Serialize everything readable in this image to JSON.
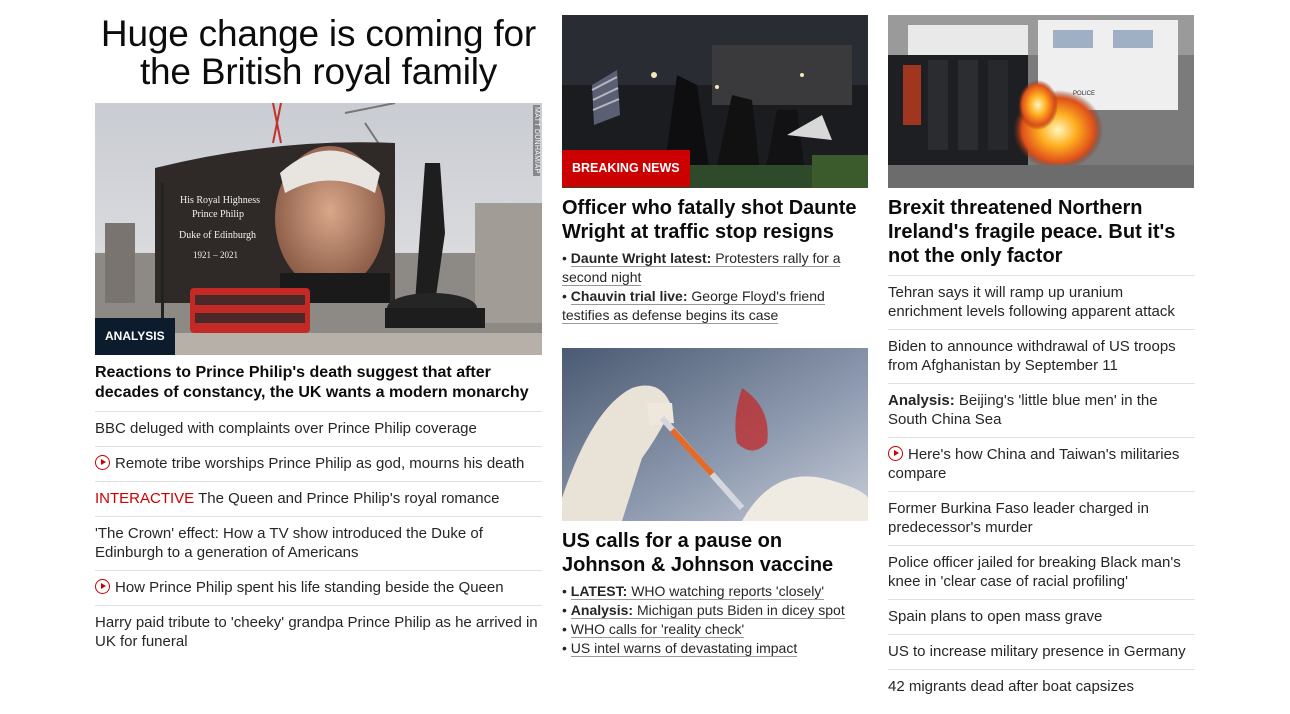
{
  "col1": {
    "title": "Huge change is coming for the British royal family",
    "image": {
      "badge": "ANALYSIS",
      "credit": "MATT DUNHAM/AP",
      "screen_lines": [
        "His Royal Highness",
        "Prince Philip",
        "Duke of Edinburgh",
        "1921 – 2021"
      ]
    },
    "caption": "Reactions to Prince Philip's death suggest that after decades of constancy, the UK wants a modern monarchy",
    "items": [
      {
        "text": "BBC deluged with complaints over Prince Philip coverage"
      },
      {
        "icon": "play-icon",
        "text": "Remote tribe worships Prince Philip as god, mourns his death"
      },
      {
        "prefix": "INTERACTIVE",
        "text": "The Queen and Prince Philip's royal romance"
      },
      {
        "text": "'The Crown' effect: How a TV show introduced the Duke of Edinburgh to a generation of Americans"
      },
      {
        "icon": "play-icon",
        "text": "How Prince Philip spent his life standing beside the Queen"
      },
      {
        "text": "Harry paid tribute to 'cheeky' grandpa Prince Philip as he arrived in UK for funeral"
      }
    ]
  },
  "col2": {
    "story1": {
      "badge": "BREAKING NEWS",
      "headline": "Officer who fatally shot Daunte Wright at traffic stop resigns",
      "bullets": [
        {
          "kicker": "Daunte Wright latest:",
          "text": "Protesters rally for a second night"
        },
        {
          "kicker": "Chauvin trial live:",
          "text": "George Floyd's friend testifies as defense begins its case"
        }
      ]
    },
    "story2": {
      "headline": "US calls for a pause on Johnson & Johnson vaccine",
      "bullets": [
        {
          "kicker": "LATEST:",
          "text": "WHO watching reports 'closely'"
        },
        {
          "kicker": "Analysis:",
          "text": "Michigan puts Biden in dicey spot"
        },
        {
          "kicker": "",
          "text": "WHO calls for 'reality check'"
        },
        {
          "kicker": "",
          "text": "US intel warns of devastating impact"
        }
      ]
    }
  },
  "col3": {
    "headline": "Brexit threatened Northern Ireland's fragile peace. But it's not the only factor",
    "image": {
      "vehicle_text": "POLICE"
    },
    "items": [
      {
        "text": "Tehran says it will ramp up uranium enrichment levels following apparent attack"
      },
      {
        "text": "Biden to announce withdrawal of US troops from Afghanistan by September 11"
      },
      {
        "prefix": "Analysis:",
        "text": "Beijing's 'little blue men' in the South China Sea"
      },
      {
        "icon": "play-icon",
        "text": "Here's how China and Taiwan's militaries compare"
      },
      {
        "text": "Former Burkina Faso leader charged in predecessor's murder"
      },
      {
        "text": "Police officer jailed for breaking Black man's knee in 'clear case of racial profiling'"
      },
      {
        "text": "Spain plans to open mass grave"
      },
      {
        "text": "US to increase military presence in Germany"
      },
      {
        "text": "42 migrants dead after boat capsizes"
      }
    ]
  },
  "colors": {
    "accent_red": "#cc0000",
    "analysis_badge": "#0c1c2c",
    "text": "#262626",
    "divider": "#e1e1e1"
  }
}
